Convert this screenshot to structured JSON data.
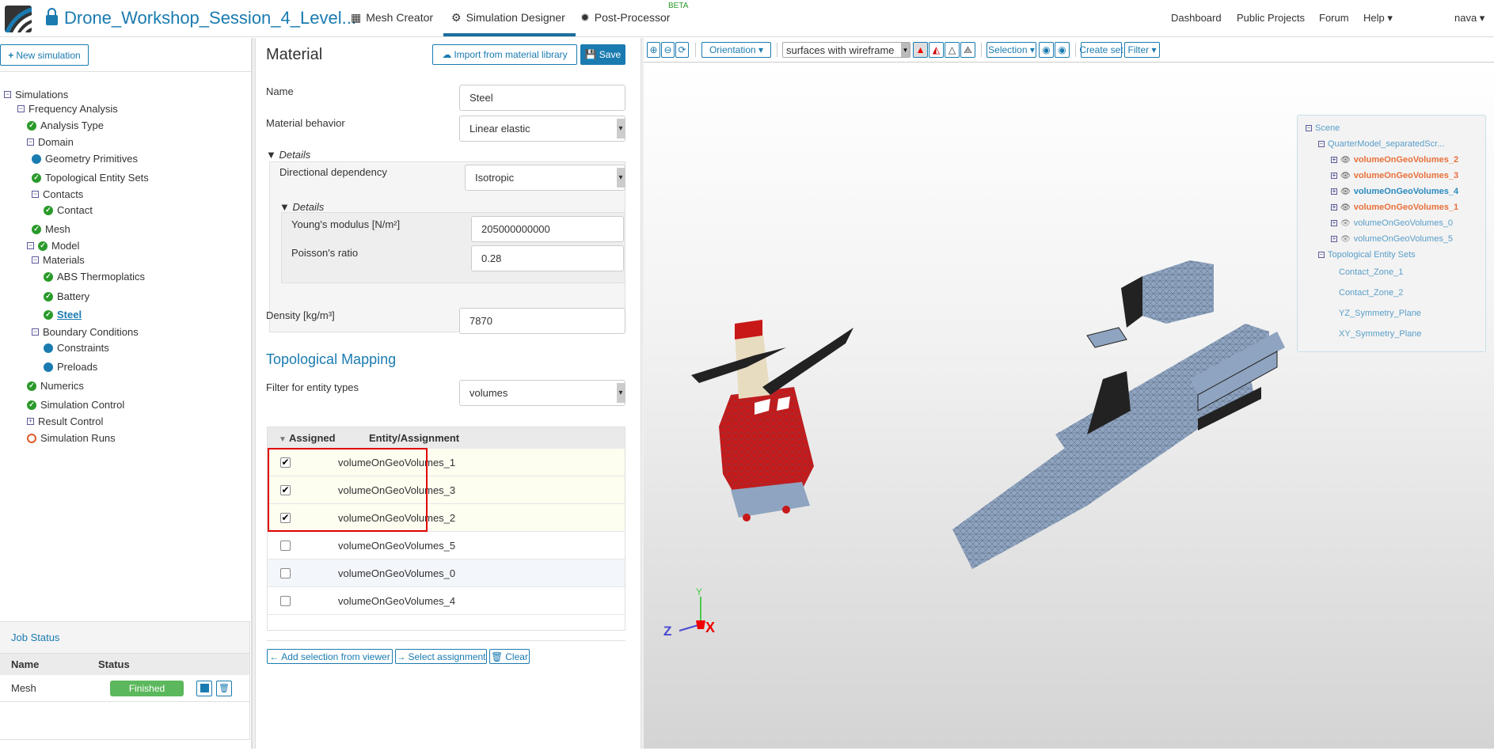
{
  "header": {
    "project_title": "Drone_Workshop_Session_4_Level...",
    "nav": [
      {
        "label": "Mesh Creator",
        "icon": "grid-icon"
      },
      {
        "label": "Simulation Designer",
        "icon": "gears-icon",
        "active": true
      },
      {
        "label": "Post-Processor",
        "icon": "cog-icon",
        "badge": "BETA"
      }
    ],
    "right_nav": [
      "Dashboard",
      "Public Projects",
      "Forum",
      "Help ▾"
    ],
    "user": "nava ▾"
  },
  "sidebar": {
    "new_simulation": "New simulation",
    "tree": [
      {
        "label": "Simulations",
        "status": "minus",
        "level": 0
      },
      {
        "label": "Frequency Analysis",
        "status": "minus",
        "level": 1
      },
      {
        "label": "Analysis Type",
        "status": "check",
        "level": 2
      },
      {
        "label": "Domain",
        "status": "minus",
        "level": 2
      },
      {
        "label": "Geometry Primitives",
        "status": "dot",
        "level": 3
      },
      {
        "label": "Topological Entity Sets",
        "status": "check",
        "level": 3
      },
      {
        "label": "Contacts",
        "status": "minus",
        "level": 3
      },
      {
        "label": "Contact",
        "status": "check",
        "level": 4
      },
      {
        "label": "Mesh",
        "status": "check",
        "level": 3
      },
      {
        "label": "Model",
        "status": "minus-check",
        "level": 2
      },
      {
        "label": "Materials",
        "status": "minus",
        "level": 3
      },
      {
        "label": "ABS Thermoplatics",
        "status": "check",
        "level": 4
      },
      {
        "label": "Battery",
        "status": "check",
        "level": 4
      },
      {
        "label": "Steel",
        "status": "check",
        "level": 4,
        "selected": true
      },
      {
        "label": "Boundary Conditions",
        "status": "minus",
        "level": 3
      },
      {
        "label": "Constraints",
        "status": "dot",
        "level": 4
      },
      {
        "label": "Preloads",
        "status": "dot",
        "level": 4
      },
      {
        "label": "Numerics",
        "status": "check",
        "level": 2
      },
      {
        "label": "Simulation Control",
        "status": "check",
        "level": 2
      },
      {
        "label": "Result Control",
        "status": "plus",
        "level": 2
      },
      {
        "label": "Simulation Runs",
        "status": "ring",
        "level": 2
      }
    ]
  },
  "job_status": {
    "title": "Job Status",
    "columns": [
      "Name",
      "Status"
    ],
    "rows": [
      {
        "name": "Mesh",
        "status": "Finished"
      }
    ]
  },
  "material": {
    "title": "Material",
    "import_label": "Import from material library",
    "save_label": "Save",
    "name_label": "Name",
    "name_value": "Steel",
    "behavior_label": "Material behavior",
    "behavior_value": "Linear elastic",
    "details_label": "Details",
    "directional_label": "Directional dependency",
    "directional_value": "Isotropic",
    "inner_details_label": "Details",
    "youngs_label": "Young's modulus [N/m²]",
    "youngs_value": "205000000000",
    "poisson_label": "Poisson's ratio",
    "poisson_value": "0.28",
    "density_label": "Density [kg/m³]",
    "density_value": "7870"
  },
  "mapping": {
    "title": "Topological Mapping",
    "filter_label": "Filter for entity types",
    "filter_value": "volumes",
    "columns": [
      "Assigned",
      "Entity/Assignment"
    ],
    "rows": [
      {
        "name": "volumeOnGeoVolumes_1",
        "assigned": true
      },
      {
        "name": "volumeOnGeoVolumes_3",
        "assigned": true
      },
      {
        "name": "volumeOnGeoVolumes_2",
        "assigned": true
      },
      {
        "name": "volumeOnGeoVolumes_5",
        "assigned": false
      },
      {
        "name": "volumeOnGeoVolumes_0",
        "assigned": false
      },
      {
        "name": "volumeOnGeoVolumes_4",
        "assigned": false
      }
    ],
    "add_selection": "Add selection from viewer",
    "select_assignment": "Select assignment",
    "clear": "Clear"
  },
  "viewer": {
    "orientation": "Orientation ▾",
    "render_mode": "surfaces with wireframe",
    "selection": "Selection ▾",
    "create_set": "Create set",
    "filter": "Filter ▾",
    "scene": {
      "root": "Scene",
      "model": "QuarterModel_separatedScr...",
      "volumes": [
        {
          "name": "volumeOnGeoVolumes_2",
          "style": "o"
        },
        {
          "name": "volumeOnGeoVolumes_3",
          "style": "o"
        },
        {
          "name": "volumeOnGeoVolumes_4",
          "style": "b"
        },
        {
          "name": "volumeOnGeoVolumes_1",
          "style": "o"
        },
        {
          "name": "volumeOnGeoVolumes_0",
          "style": ""
        },
        {
          "name": "volumeOnGeoVolumes_5",
          "style": ""
        }
      ],
      "sets_label": "Topological Entity Sets",
      "sets": [
        "Contact_Zone_1",
        "Contact_Zone_2",
        "YZ_Symmetry_Plane",
        "XY_Symmetry_Plane"
      ]
    },
    "axes": {
      "y": "Y",
      "z": "Z",
      "x": "X"
    }
  },
  "colors": {
    "accent": "#1a7bb0",
    "success": "#5cb85c",
    "highlight": "#e00000"
  }
}
